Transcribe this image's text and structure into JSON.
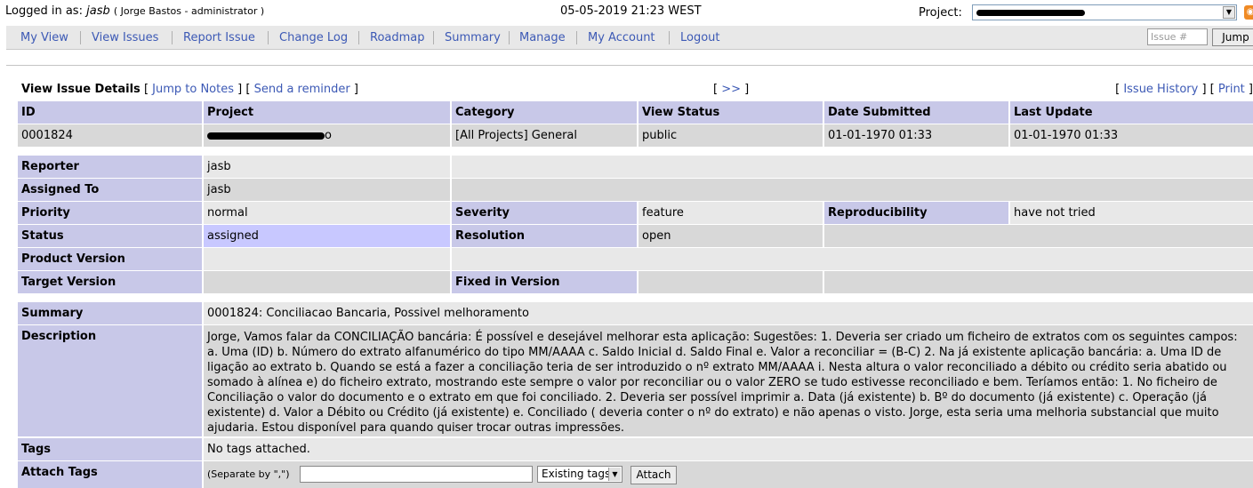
{
  "login": {
    "prefix": "Logged in as:",
    "user": "jasb",
    "full": "( Jorge Bastos - administrator )"
  },
  "datetime": "05-05-2019 21:23 WEST",
  "project_label": "Project:",
  "menu": {
    "items": [
      "My View",
      "View Issues",
      "Report Issue",
      "Change Log",
      "Roadmap",
      "Summary",
      "Manage",
      "My Account",
      "Logout"
    ],
    "issue_placeholder": "Issue #",
    "jump_label": "Jump"
  },
  "details": {
    "title": "View Issue Details",
    "jump_to_notes": "Jump to Notes",
    "send_reminder": "Send a reminder",
    "next": ">>",
    "issue_history": "Issue History",
    "print": "Print"
  },
  "header": {
    "id": "ID",
    "project": "Project",
    "category": "Category",
    "view_status": "View Status",
    "date_submitted": "Date Submitted",
    "last_update": "Last Update"
  },
  "issue": {
    "id": "0001824",
    "project_tail": "o",
    "category": "[All Projects] General",
    "view_status": "public",
    "date_submitted": "01-01-1970 01:33",
    "last_update": "01-01-1970 01:33"
  },
  "fields": {
    "reporter_label": "Reporter",
    "reporter": "jasb",
    "assigned_label": "Assigned To",
    "assigned": "jasb",
    "priority_label": "Priority",
    "priority": "normal",
    "severity_label": "Severity",
    "severity": "feature",
    "reproducibility_label": "Reproducibility",
    "reproducibility": "have not tried",
    "status_label": "Status",
    "status": "assigned",
    "resolution_label": "Resolution",
    "resolution": "open",
    "product_version_label": "Product Version",
    "target_version_label": "Target Version",
    "fixed_in_version_label": "Fixed in Version",
    "summary_label": "Summary",
    "summary": "0001824: Conciliacao Bancaria, Possivel melhoramento",
    "description_label": "Description",
    "description": "Jorge, Vamos falar da CONCILIAÇÃO bancária: É possível e desejável melhorar esta aplicação: Sugestões: 1. Deveria ser criado um ficheiro de extratos com os seguintes campos: a. Uma (ID) b. Número do extrato alfanumérico do tipo MM/AAAA c. Saldo Inicial d. Saldo Final e. Valor a reconciliar = (B-C) 2. Na já existente aplicação bancária: a. Uma ID de ligação ao extrato b. Quando se está a fazer a conciliação teria de ser introduzido o nº extrato MM/AAAA i. Nesta altura o valor reconciliado a débito ou crédito seria abatido ou somado à alínea e) do ficheiro extrato, mostrando este sempre o valor por reconciliar ou o valor ZERO se tudo estivesse reconciliado e bem. Teríamos então: 1. No ficheiro de Conciliação o valor do documento e o extrato em que foi conciliado. 2. Deveria ser possível imprimir a. Data (já existente) b. Bº do documento (já existente) c. Operação (já existente) d. Valor a Débito ou Crédito (já existente) e. Conciliado ( deveria conter o nº do extrato) e não apenas o visto. Jorge, esta seria uma melhoria substancial que muito ajudaria. Estou disponível para quando quiser trocar outras impressões.",
    "tags_label": "Tags",
    "tags": "No tags attached.",
    "attach_tags_label": "Attach Tags",
    "separate_note": "(Separate by \",\")",
    "existing_tags": "Existing tags",
    "attach_button": "Attach"
  }
}
